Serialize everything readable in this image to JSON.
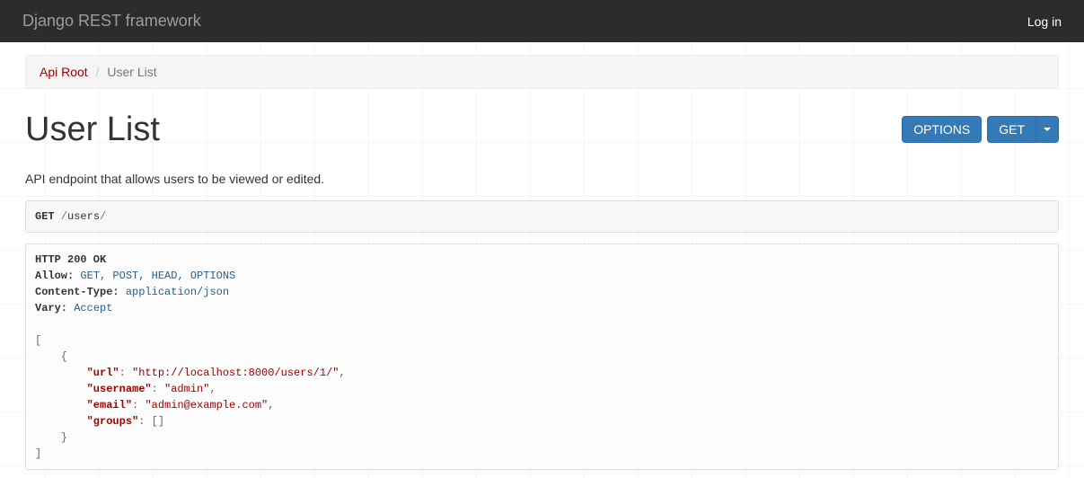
{
  "navbar": {
    "brand": "Django REST framework",
    "login": "Log in"
  },
  "breadcrumb": {
    "root": "Api Root",
    "sep": "/",
    "current": "User List"
  },
  "page": {
    "title": "User List",
    "desc": "API endpoint that allows users to be viewed or edited."
  },
  "buttons": {
    "options": "OPTIONS",
    "get": "GET"
  },
  "request": {
    "method": "GET",
    "path_pre": " /",
    "path_mid": "users",
    "path_suf": "/"
  },
  "response": {
    "status": "HTTP 200 OK",
    "headers": {
      "allow_k": "Allow:",
      "allow_v": "GET, POST, HEAD, OPTIONS",
      "ct_k": "Content-Type:",
      "ct_v": "application/json",
      "vary_k": "Vary:",
      "vary_v": "Accept"
    },
    "body": {
      "open": "[",
      "obj_open": "    {",
      "k_url": "\"url\"",
      "v_url": "\"http://localhost:8000/users/1/\"",
      "k_username": "\"username\"",
      "v_username": "\"admin\"",
      "k_email": "\"email\"",
      "v_email": "\"admin@example.com\"",
      "k_groups": "\"groups\"",
      "v_groups": "[]",
      "obj_close": "    }",
      "close": "]"
    }
  }
}
